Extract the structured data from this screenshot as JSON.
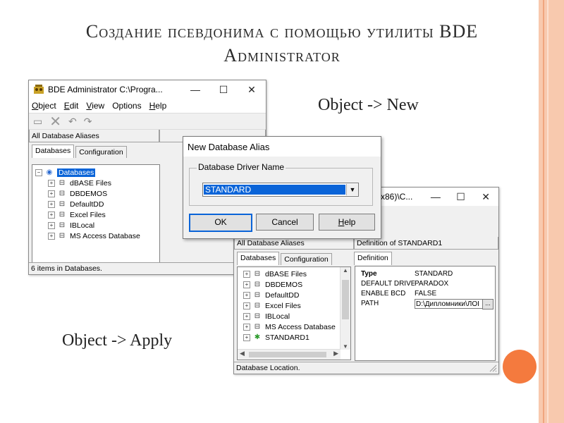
{
  "slide": {
    "title_line1": "Создание псевдонима с помощью утилиты BDE",
    "title_line2": "Administrator",
    "caption_new": "Object -> New",
    "caption_apply": "Object -> Apply",
    "colors": {
      "accent_band": "#f8c9ae",
      "accent_dot": "#f47a3e",
      "selection": "#0a64d8"
    }
  },
  "window1": {
    "title": "BDE Administrator  C:\\Progra...",
    "controls": [
      "—",
      "☐",
      "✕"
    ],
    "menu": [
      {
        "first": "O",
        "rest": "bject"
      },
      {
        "first": "E",
        "rest": "dit"
      },
      {
        "first": "V",
        "rest": "iew"
      },
      {
        "first": "",
        "rest": "Options"
      },
      {
        "first": "H",
        "rest": "elp"
      }
    ],
    "pane_header": "All Database Aliases",
    "tabs": [
      "Databases",
      "Configuration"
    ],
    "tree_root": "Databases",
    "tree_items": [
      "dBASE Files",
      "DBDEMOS",
      "DefaultDD",
      "Excel Files",
      "IBLocal",
      "MS Access Database"
    ],
    "status": "6 items in Databases."
  },
  "dialog": {
    "title": "New Database Alias",
    "group_label": "Database Driver Name",
    "selected_driver": "STANDARD",
    "ok_label": "OK",
    "cancel_label": "Cancel",
    "help_label_first": "H",
    "help_label_rest": "elp"
  },
  "window2": {
    "title_tail": "x86)\\C...",
    "controls": [
      "—",
      "☐",
      "✕"
    ],
    "pane_left_header": "All Database Aliases",
    "pane_right_header": "Definition of STANDARD1",
    "tabs_left": [
      "Databases",
      "Configuration"
    ],
    "tabs_right": [
      "Definition"
    ],
    "tree_items": [
      "dBASE Files",
      "DBDEMOS",
      "DefaultDD",
      "Excel Files",
      "IBLocal",
      "MS Access Database",
      "STANDARD1"
    ],
    "properties": [
      {
        "key": "Type",
        "value": "STANDARD"
      },
      {
        "key": "DEFAULT DRIVER",
        "value": "PARADOX"
      },
      {
        "key": "ENABLE BCD",
        "value": "FALSE"
      },
      {
        "key": "PATH",
        "value": "D:\\Дипломники\\ЛОI"
      }
    ],
    "path_button": "...",
    "status": "Database Location."
  }
}
